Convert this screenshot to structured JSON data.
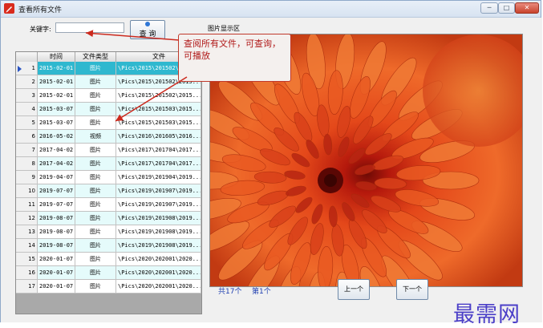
{
  "window": {
    "title": "查看所有文件",
    "controls": [
      "─",
      "□",
      "✕"
    ]
  },
  "search": {
    "label": "关键字:",
    "value": "",
    "button_label": "查 询"
  },
  "image_area": {
    "label": "图片显示区"
  },
  "grid": {
    "headers": [
      "时间",
      "文件类型",
      "文件"
    ],
    "rows": [
      {
        "idx": "1",
        "date": "2015-02-01",
        "type": "图片",
        "path": "\\Pics\\2015\\201502\\2015..."
      },
      {
        "idx": "2",
        "date": "2015-02-01",
        "type": "图片",
        "path": "\\Pics\\2015\\201502\\2015..."
      },
      {
        "idx": "3",
        "date": "2015-02-01",
        "type": "图片",
        "path": "\\Pics\\2015\\201502\\2015..."
      },
      {
        "idx": "4",
        "date": "2015-03-07",
        "type": "图片",
        "path": "\\Pics\\2015\\201503\\2015..."
      },
      {
        "idx": "5",
        "date": "2015-03-07",
        "type": "图片",
        "path": "\\Pics\\2015\\201503\\2015..."
      },
      {
        "idx": "6",
        "date": "2016-05-02",
        "type": "视频",
        "path": "\\Pics\\2016\\201605\\2016..."
      },
      {
        "idx": "7",
        "date": "2017-04-02",
        "type": "图片",
        "path": "\\Pics\\2017\\201704\\2017..."
      },
      {
        "idx": "8",
        "date": "2017-04-02",
        "type": "图片",
        "path": "\\Pics\\2017\\201704\\2017..."
      },
      {
        "idx": "9",
        "date": "2019-04-07",
        "type": "图片",
        "path": "\\Pics\\2019\\201904\\2019..."
      },
      {
        "idx": "10",
        "date": "2019-07-07",
        "type": "图片",
        "path": "\\Pics\\2019\\201907\\2019..."
      },
      {
        "idx": "11",
        "date": "2019-07-07",
        "type": "图片",
        "path": "\\Pics\\2019\\201907\\2019..."
      },
      {
        "idx": "12",
        "date": "2019-08-07",
        "type": "图片",
        "path": "\\Pics\\2019\\201908\\2019..."
      },
      {
        "idx": "13",
        "date": "2019-08-07",
        "type": "图片",
        "path": "\\Pics\\2019\\201908\\2019..."
      },
      {
        "idx": "14",
        "date": "2019-08-07",
        "type": "图片",
        "path": "\\Pics\\2019\\201908\\2019..."
      },
      {
        "idx": "15",
        "date": "2020-01-07",
        "type": "图片",
        "path": "\\Pics\\2020\\202001\\2020..."
      },
      {
        "idx": "16",
        "date": "2020-01-07",
        "type": "图片",
        "path": "\\Pics\\2020\\202001\\2020..."
      },
      {
        "idx": "17",
        "date": "2020-01-07",
        "type": "图片",
        "path": "\\Pics\\2020\\202001\\2020..."
      }
    ],
    "selected_row": 1
  },
  "status": {
    "total": "共17个",
    "page": "第1个"
  },
  "nav": {
    "prev_label": "上一个",
    "next_label": "下一个"
  },
  "callout": {
    "text": "查阅所有文件，可查询，可播放"
  },
  "watermark": {
    "text": "最需网"
  },
  "colors": {
    "selected_row": "#2fb8cf",
    "alt_row": "#e5fbfb",
    "accent_blue": "#1f3fb0",
    "callout_red": "#b01818",
    "flower": "#e8501c"
  },
  "icons": {
    "app": "app-pencil-icon",
    "row_pointer": "row-pointer-icon"
  }
}
